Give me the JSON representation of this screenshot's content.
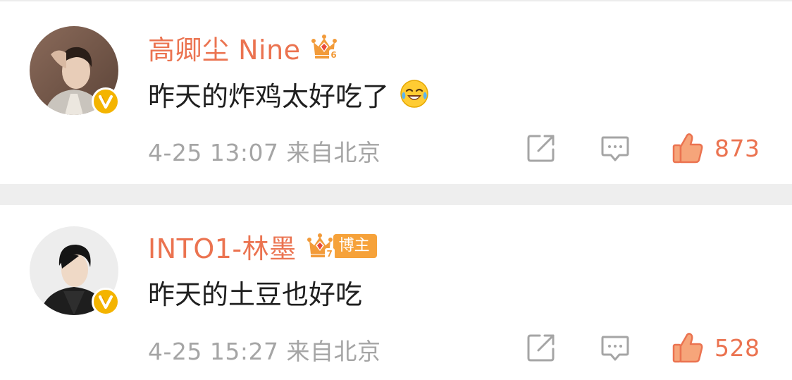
{
  "comments": [
    {
      "username": "高卿尘 Nine",
      "crown_level": "6",
      "badge_label": "",
      "text": "昨天的炸鸡太好吃了",
      "has_emoji": true,
      "emoji_icon": "laughing-crying-emoji-icon",
      "time": "4-25 13:07",
      "source": "来自北京",
      "likes": "873"
    },
    {
      "username": "INTO1-林墨",
      "crown_level": "7",
      "badge_label": "博主",
      "text": "昨天的土豆也好吃",
      "has_emoji": false,
      "time": "4-25 15:27",
      "source": "来自北京",
      "likes": "528"
    }
  ],
  "colors": {
    "username": "#eb7350",
    "like": "#eb7350",
    "meta": "#a5a5a5",
    "verified_badge": "#f4b400",
    "crown": "#f29b3a",
    "blogger_tag": "#f6a23a",
    "separator": "#eeeeee"
  },
  "icons": {
    "verified": "verified-v-icon",
    "crown": "crown-icon",
    "share": "share-icon",
    "reply": "comment-icon",
    "like": "thumbs-up-icon"
  }
}
